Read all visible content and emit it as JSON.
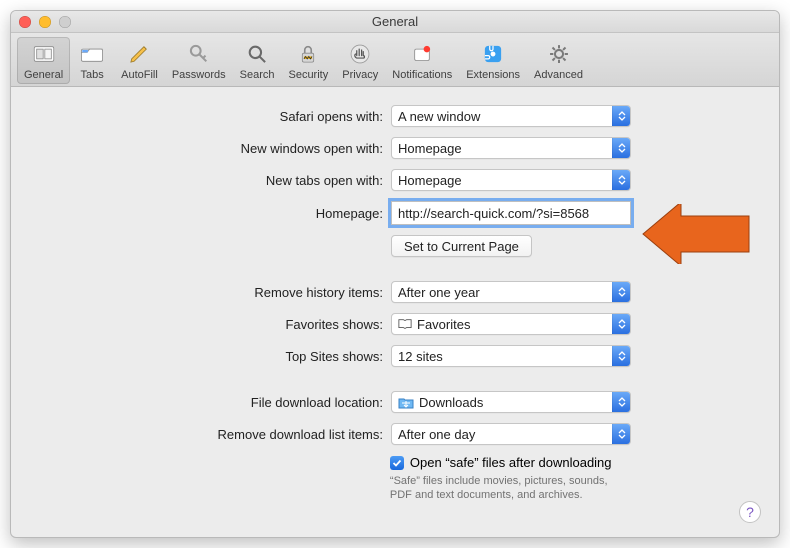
{
  "window": {
    "title": "General"
  },
  "toolbar": {
    "items": [
      {
        "label": "General"
      },
      {
        "label": "Tabs"
      },
      {
        "label": "AutoFill"
      },
      {
        "label": "Passwords"
      },
      {
        "label": "Search"
      },
      {
        "label": "Security"
      },
      {
        "label": "Privacy"
      },
      {
        "label": "Notifications"
      },
      {
        "label": "Extensions"
      },
      {
        "label": "Advanced"
      }
    ]
  },
  "form": {
    "safari_opens_label": "Safari opens with:",
    "safari_opens_value": "A new window",
    "new_windows_label": "New windows open with:",
    "new_windows_value": "Homepage",
    "new_tabs_label": "New tabs open with:",
    "new_tabs_value": "Homepage",
    "homepage_label": "Homepage:",
    "homepage_value": "http://search-quick.com/?si=8568",
    "set_current_btn": "Set to Current Page",
    "remove_history_label": "Remove history items:",
    "remove_history_value": "After one year",
    "favorites_label": "Favorites shows:",
    "favorites_value": "Favorites",
    "topsites_label": "Top Sites shows:",
    "topsites_value": "12 sites",
    "download_loc_label": "File download location:",
    "download_loc_value": "Downloads",
    "remove_downloads_label": "Remove download list items:",
    "remove_downloads_value": "After one day",
    "safe_files_check_label": "Open “safe” files after downloading",
    "safe_files_fineprint": "“Safe” files include movies, pictures, sounds, PDF and text documents, and archives."
  },
  "colors": {
    "accent": "#3478f6",
    "arrow": "#e8651d"
  }
}
